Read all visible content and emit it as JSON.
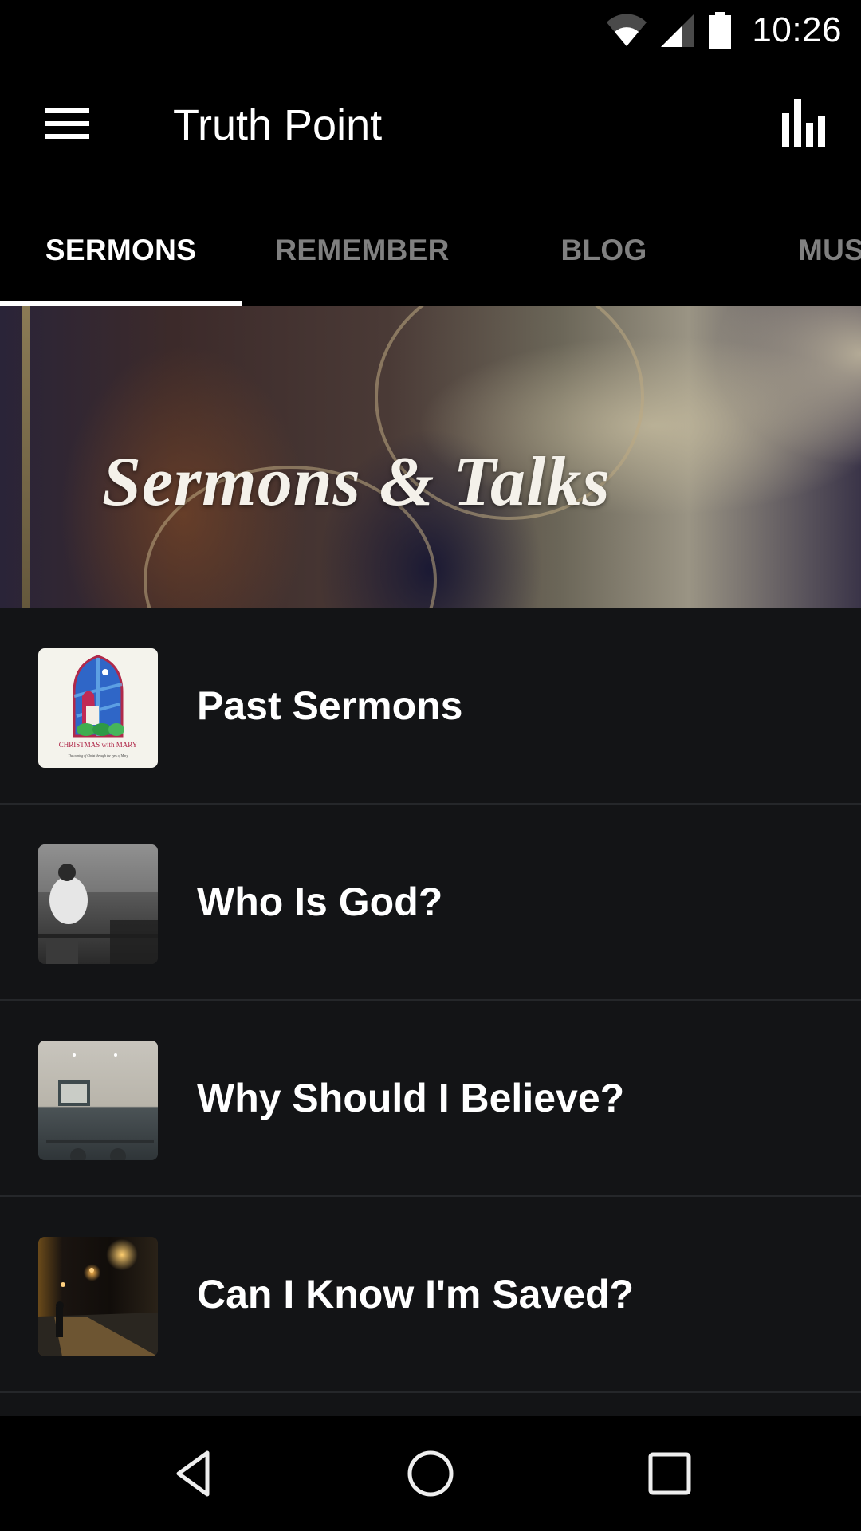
{
  "status_bar": {
    "time": "10:26",
    "icons": [
      "wifi-icon",
      "cell-signal-icon",
      "battery-icon"
    ]
  },
  "app_bar": {
    "title": "Truth Point",
    "menu_icon": "hamburger-menu-icon",
    "action_icon": "equalizer-icon"
  },
  "tabs": [
    {
      "label": "SERMONS",
      "active": true
    },
    {
      "label": "REMEMBER",
      "active": false
    },
    {
      "label": "BLOG",
      "active": false
    },
    {
      "label": "MUS",
      "active": false
    }
  ],
  "banner": {
    "title": "Sermons & Talks"
  },
  "list": {
    "items": [
      {
        "label": "Past Sermons",
        "thumbnail": "christmas-with-mary-image",
        "thumb_caption": "CHRISTMAS with MARY",
        "thumb_subcaption": "The coming of Christ through the eyes of Mary"
      },
      {
        "label": "Who Is God?",
        "thumbnail": "man-at-cafe-image"
      },
      {
        "label": "Why Should I Believe?",
        "thumbnail": "empty-room-image"
      },
      {
        "label": "Can I Know I'm Saved?",
        "thumbnail": "night-street-image"
      }
    ]
  },
  "nav_bar": {
    "back": "back-icon",
    "home": "home-icon",
    "recents": "recents-icon"
  },
  "colors": {
    "background": "#131416",
    "bar": "#000000",
    "active_tab": "#ffffff",
    "inactive_tab": "#808080",
    "divider": "#25272a"
  }
}
